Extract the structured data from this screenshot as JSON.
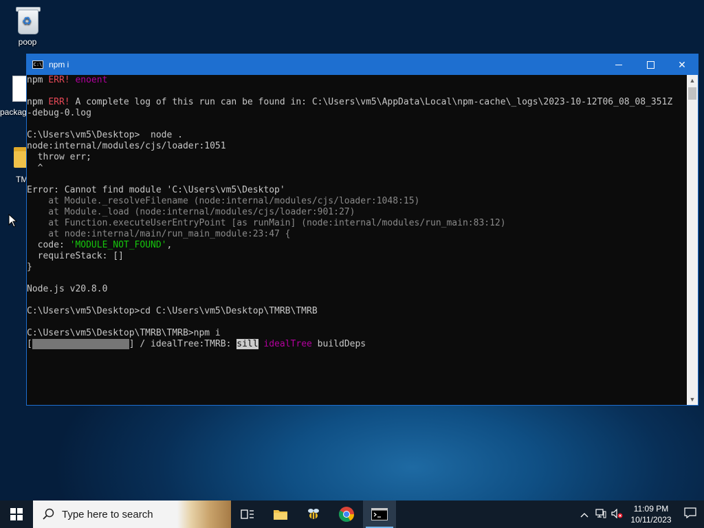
{
  "desktop": {
    "icons": [
      {
        "label": "poop"
      },
      {
        "label": "packag"
      },
      {
        "label": "TM"
      }
    ]
  },
  "window": {
    "title": "npm i",
    "icon_text": "C:\\",
    "close_glyph": "✕"
  },
  "terminal": {
    "l1a": "npm ",
    "l1b": "ERR!",
    "l1c": " enoent",
    "l3a": "npm ",
    "l3b": "ERR!",
    "l3c": " A complete log of this run can be found in: C:\\Users\\vm5\\AppData\\Local\\npm-cache\\_logs\\2023-10-12T06_08_08_351Z",
    "l4": "-debug-0.log",
    "l6": "C:\\Users\\vm5\\Desktop>  node .",
    "l7": "node:internal/modules/cjs/loader:1051",
    "l8": "  throw err;",
    "l9": "  ^",
    "l11": "Error: Cannot find module 'C:\\Users\\vm5\\Desktop'",
    "l12": "    at Module._resolveFilename (node:internal/modules/cjs/loader:1048:15)",
    "l13": "    at Module._load (node:internal/modules/cjs/loader:901:27)",
    "l14": "    at Function.executeUserEntryPoint [as runMain] (node:internal/modules/run_main:83:12)",
    "l15": "    at node:internal/main/run_main_module:23:47 {",
    "l16a": "  code: ",
    "l16b": "'MODULE_NOT_FOUND'",
    "l16c": ",",
    "l17": "  requireStack: []",
    "l18": "}",
    "l20": "Node.js v20.8.0",
    "l22": "C:\\Users\\vm5\\Desktop>cd C:\\Users\\vm5\\Desktop\\TMRB\\TMRB",
    "l24": "C:\\Users\\vm5\\Desktop\\TMRB\\TMRB>npm i",
    "l25a": "[",
    "l25bar": "                  ",
    "l25b": "] / idealTree:TMRB: ",
    "l25sill": "sill",
    "l25c": " ",
    "l25idt": "idealTree",
    "l25d": " buildDeps"
  },
  "taskbar": {
    "search_placeholder": "Type here to search",
    "clock_time": "11:09 PM",
    "clock_date": "10/11/2023"
  },
  "colors": {
    "accent": "#1e6fd0",
    "err": "#e74856",
    "magenta": "#b4009e",
    "green": "#16c60c"
  }
}
